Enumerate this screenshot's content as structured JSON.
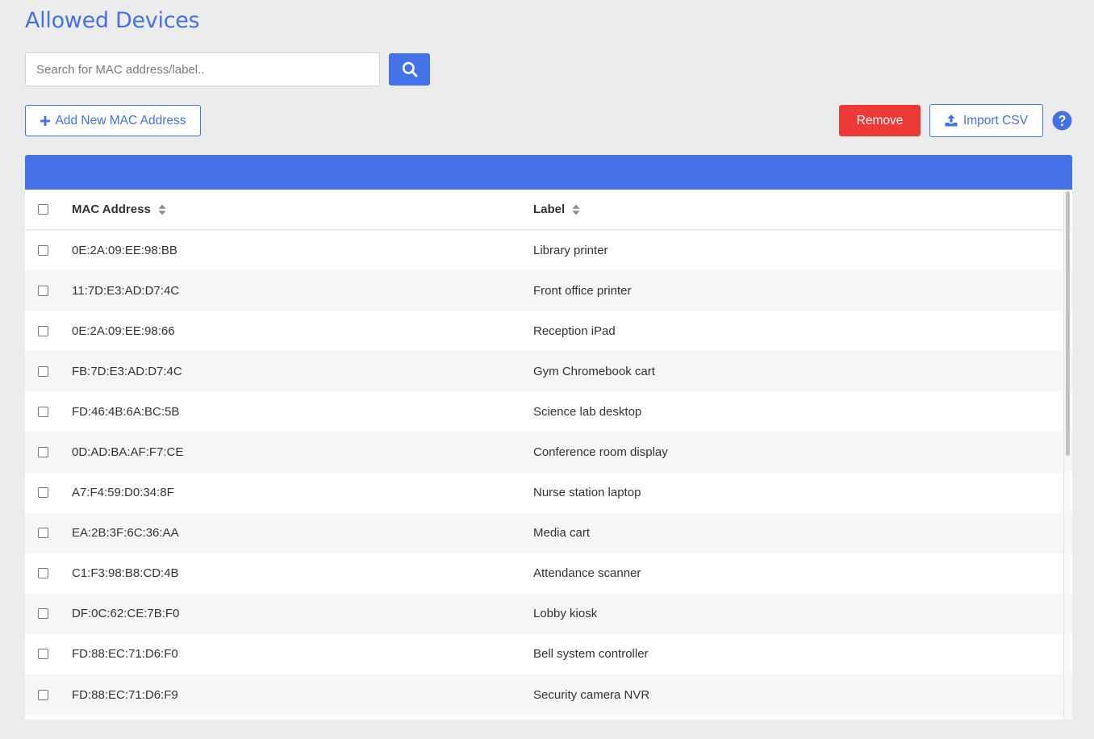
{
  "page": {
    "title": "Allowed Devices"
  },
  "search": {
    "placeholder": "Search for MAC address/label..",
    "value": ""
  },
  "toolbar": {
    "add_label": "Add New MAC Address",
    "remove_label": "Remove",
    "import_label": "Import CSV"
  },
  "table": {
    "columns": {
      "mac": "MAC Address",
      "label": "Label"
    },
    "rows": [
      {
        "mac": "0E:2A:09:EE:98:BB",
        "label": "Library printer"
      },
      {
        "mac": "11:7D:E3:AD:D7:4C",
        "label": "Front office printer"
      },
      {
        "mac": "0E:2A:09:EE:98:66",
        "label": "Reception iPad"
      },
      {
        "mac": "FB:7D:E3:AD:D7:4C",
        "label": "Gym Chromebook cart"
      },
      {
        "mac": "FD:46:4B:6A:BC:5B",
        "label": "Science lab desktop"
      },
      {
        "mac": "0D:AD:BA:AF:F7:CE",
        "label": "Conference room display"
      },
      {
        "mac": "A7:F4:59:D0:34:8F",
        "label": "Nurse station laptop"
      },
      {
        "mac": "EA:2B:3F:6C:36:AA",
        "label": "Media cart"
      },
      {
        "mac": "C1:F3:98:B8:CD:4B",
        "label": "Attendance scanner"
      },
      {
        "mac": "DF:0C:62:CE:7B:F0",
        "label": "Lobby kiosk"
      },
      {
        "mac": "FD:88:EC:71:D6:F0",
        "label": "Bell system controller"
      },
      {
        "mac": "FD:88:EC:71:D6:F9",
        "label": "Security camera NVR"
      }
    ]
  },
  "icons": {
    "search": "search-icon",
    "add": "plus-icon",
    "import": "upload-icon",
    "help": "question-circle-icon",
    "sort": "sort-icon"
  },
  "colors": {
    "primary": "#4571e6",
    "danger": "#ee3a36",
    "background": "#ececec"
  }
}
